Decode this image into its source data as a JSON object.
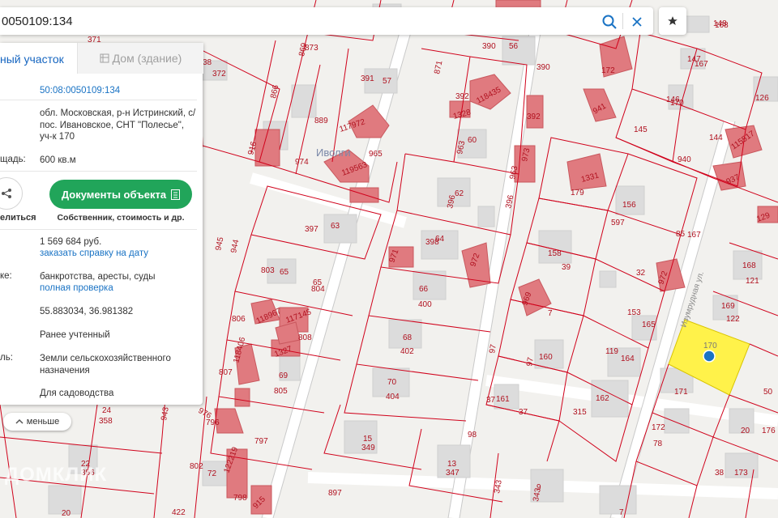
{
  "search": {
    "value": "0050109:134"
  },
  "tabs": {
    "active": "ный участок",
    "inactive": "Дом (здание)"
  },
  "parcel": {
    "cadastral_number": "50:08:0050109:134",
    "address": "обл. Московская, р-н Истринский, с/пос. Ивановское, СНТ \"Полесье\", уч-к 170",
    "area_label": "щадь:",
    "area_value": "600 кв.м",
    "share_label": "елиться",
    "docs_button": "Документы объекта",
    "docs_subtitle": "Собственник, стоимость и др.",
    "value": "1 569 684 руб.",
    "value_link": "заказать справку на дату",
    "risk_label": "ке:",
    "risk_value": "банкротства, аресты, суды",
    "risk_link": "полная проверка",
    "coordinates": "55.883034, 36.981382",
    "status": "Ранее учтенный",
    "category_label": "ль:",
    "category_value": "Земли сельскохозяйственного назначения",
    "use": "Для садоводства"
  },
  "collapse_button": "меньше",
  "watermark": "ДОМКЛИК",
  "map": {
    "locality_label": "Иволги",
    "street_label": "Изумрудная ул.",
    "selected_parcel": "170",
    "parcel_numbers": [
      {
        "t": "148"
      },
      {
        "t": "168"
      },
      {
        "t": "371"
      },
      {
        "t": "38"
      },
      {
        "t": "372"
      },
      {
        "t": "869"
      },
      {
        "t": "873"
      },
      {
        "t": "390"
      },
      {
        "t": "56"
      },
      {
        "t": "390"
      },
      {
        "t": "172"
      },
      {
        "t": "147"
      },
      {
        "t": "167"
      },
      {
        "t": "126"
      },
      {
        "t": "391"
      },
      {
        "t": "57"
      },
      {
        "t": "871"
      },
      {
        "t": "392"
      },
      {
        "t": "118435"
      },
      {
        "t": "1328"
      },
      {
        "t": "392"
      },
      {
        "t": "941"
      },
      {
        "t": "146"
      },
      {
        "t": "170"
      },
      {
        "t": "866"
      },
      {
        "t": "889"
      },
      {
        "t": "117972"
      },
      {
        "t": "965"
      },
      {
        "t": "60"
      },
      {
        "t": "963"
      },
      {
        "t": "145"
      },
      {
        "t": "144"
      },
      {
        "t": "115517"
      },
      {
        "t": "940"
      },
      {
        "t": "916"
      },
      {
        "t": "974"
      },
      {
        "t": "119563"
      },
      {
        "t": "973"
      },
      {
        "t": "963"
      },
      {
        "t": "1331"
      },
      {
        "t": "179"
      },
      {
        "t": "937"
      },
      {
        "t": "62"
      },
      {
        "t": "396"
      },
      {
        "t": "396"
      },
      {
        "t": "156"
      },
      {
        "t": "597"
      },
      {
        "t": "129"
      },
      {
        "t": "63"
      },
      {
        "t": "397"
      },
      {
        "t": "85"
      },
      {
        "t": "167"
      },
      {
        "t": "945"
      },
      {
        "t": "944"
      },
      {
        "t": "398"
      },
      {
        "t": "64"
      },
      {
        "t": "971"
      },
      {
        "t": "972"
      },
      {
        "t": "158"
      },
      {
        "t": "39"
      },
      {
        "t": "32"
      },
      {
        "t": "972"
      },
      {
        "t": "168"
      },
      {
        "t": "121"
      },
      {
        "t": "803"
      },
      {
        "t": "65"
      },
      {
        "t": "65"
      },
      {
        "t": "804"
      },
      {
        "t": "66"
      },
      {
        "t": "400"
      },
      {
        "t": "969"
      },
      {
        "t": "7"
      },
      {
        "t": "153"
      },
      {
        "t": "165"
      },
      {
        "t": "169"
      },
      {
        "t": "122"
      },
      {
        "t": "806"
      },
      {
        "t": "118967"
      },
      {
        "t": "117145"
      },
      {
        "t": "808"
      },
      {
        "t": "68"
      },
      {
        "t": "402"
      },
      {
        "t": "97"
      },
      {
        "t": "160"
      },
      {
        "t": "97"
      },
      {
        "t": "119"
      },
      {
        "t": "164"
      },
      {
        "t": "807"
      },
      {
        "t": "118406"
      },
      {
        "t": "1327"
      },
      {
        "t": "69"
      },
      {
        "t": "805"
      },
      {
        "t": "70"
      },
      {
        "t": "404"
      },
      {
        "t": "37"
      },
      {
        "t": "161"
      },
      {
        "t": "37"
      },
      {
        "t": "162"
      },
      {
        "t": "315"
      },
      {
        "t": "171"
      },
      {
        "t": "50"
      },
      {
        "t": "24"
      },
      {
        "t": "358"
      },
      {
        "t": "976"
      },
      {
        "t": "796"
      },
      {
        "t": "943"
      },
      {
        "t": "797"
      },
      {
        "t": "15"
      },
      {
        "t": "349"
      },
      {
        "t": "98"
      },
      {
        "t": "172"
      },
      {
        "t": "78"
      },
      {
        "t": "20"
      },
      {
        "t": "176"
      },
      {
        "t": "22"
      },
      {
        "t": "356"
      },
      {
        "t": "802"
      },
      {
        "t": "72"
      },
      {
        "t": "122219"
      },
      {
        "t": "13"
      },
      {
        "t": "347"
      },
      {
        "t": "38"
      },
      {
        "t": "173"
      },
      {
        "t": "20"
      },
      {
        "t": "422"
      },
      {
        "t": "798"
      },
      {
        "t": "915"
      },
      {
        "t": "897"
      },
      {
        "t": "343"
      },
      {
        "t": "9"
      },
      {
        "t": "343"
      },
      {
        "t": "7"
      }
    ]
  },
  "colors": {
    "boundary": "#d0021b",
    "building": "#e07a7f",
    "house": "#dcdcdc",
    "selected": "#fff24a",
    "marker": "#1a73c4",
    "accent_green": "#21a55a"
  }
}
